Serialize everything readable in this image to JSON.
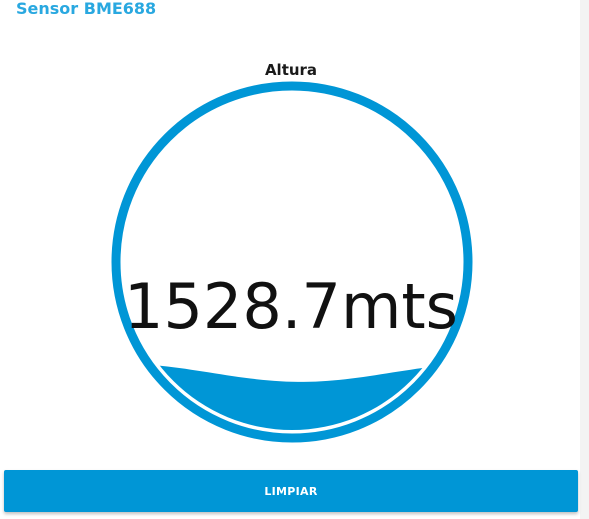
{
  "app": {
    "title": "Sensor BME688"
  },
  "gauge": {
    "label": "Altura",
    "value_text": "1528.7mts",
    "value": 1528.7,
    "unit": "mts",
    "fill_fraction": 0.17,
    "ring_color": "#0096d6",
    "liquid_color": "#0096d6",
    "icon": "liquid-fill-gauge"
  },
  "actions": {
    "clear_label": "LIMPIAR",
    "button_color": "#0096d6"
  }
}
